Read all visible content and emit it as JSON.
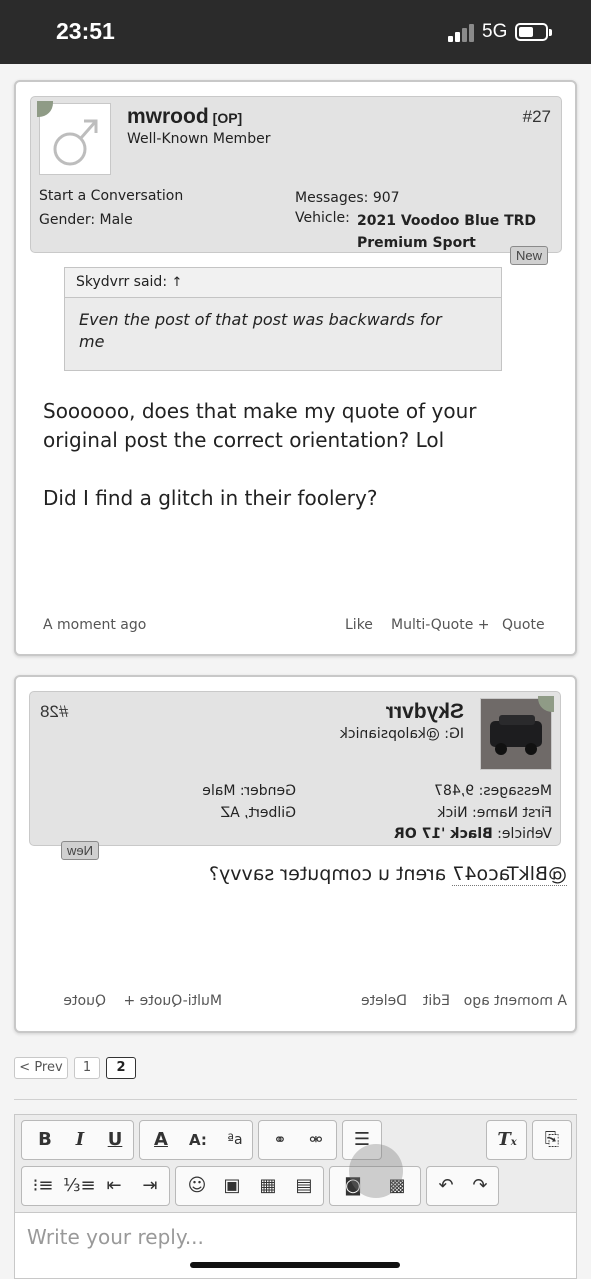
{
  "status_bar": {
    "time": "23:51",
    "network": "5G"
  },
  "post1": {
    "username": "mwrood",
    "op_tag": "[OP]",
    "user_title": "Well-Known Member",
    "post_number": "#27",
    "start_conversation": "Start a Conversation",
    "gender_label": "Gender:",
    "gender_value": "Male",
    "messages_label": "Messages:",
    "messages_value": "907",
    "vehicle_label": "Vehicle:",
    "vehicle_line1": "2021 Voodoo Blue TRD",
    "vehicle_line2": "Premium Sport",
    "new_tag": "New",
    "quote_author": "Skydvrr said:",
    "quote_arrow": "↑",
    "quote_line1": "Even the post of that post was backwards for",
    "quote_line2": "me",
    "body_line1": "Soooooo, does that make my quote of your",
    "body_line2": "original post the correct orientation? Lol",
    "body_line3": "Did I find a glitch in their foolery?",
    "timestamp": "A moment ago",
    "like": "Like",
    "multi_quote": "Multi-Quote +",
    "quote_btn": "Quote"
  },
  "post2": {
    "username": "Skydvrr",
    "user_title": "IG: @kalopsianick",
    "post_number": "#28",
    "messages_label": "Messages:",
    "messages_value": "9,487",
    "first_name_label": "First Name:",
    "first_name_value": "Nick",
    "vehicle_label": "Vehicle:",
    "vehicle_value": "Black '17 OR",
    "gender_label": "Gender:",
    "gender_value": "Male",
    "location_value": "Gilbert, AZ",
    "new_tag": "New",
    "mention": "@BlkTaco47",
    "body_rest": " arent u computer savvy?",
    "timestamp": "A moment ago",
    "edit": "Edit",
    "delete": "Delete",
    "multi_quote": "Multi-Quote +",
    "quote_btn": "Quote"
  },
  "pagination": {
    "prev": "< Prev",
    "page1": "1",
    "page2": "2"
  },
  "editor": {
    "placeholder": "Write your reply..."
  }
}
